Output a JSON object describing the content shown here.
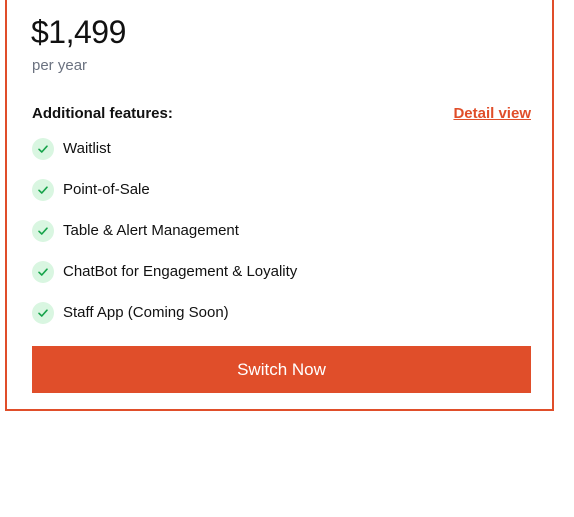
{
  "plan": {
    "price": "$1,499",
    "period": "per year"
  },
  "features": {
    "heading": "Additional features:",
    "detail_link": "Detail view",
    "items": [
      {
        "label": "Waitlist",
        "icon": "check-icon"
      },
      {
        "label": "Point-of-Sale",
        "icon": "check-icon"
      },
      {
        "label": "Table & Alert Management",
        "icon": "check-icon"
      },
      {
        "label": "ChatBot for Engagement & Loyality",
        "icon": "check-icon"
      },
      {
        "label": "Staff App (Coming Soon)",
        "icon": "check-icon"
      }
    ]
  },
  "cta": {
    "label": "Switch Now"
  },
  "colors": {
    "accent": "#e04e2a",
    "check_bg": "#d9f6e1",
    "check_mark": "#16a34a",
    "muted_text": "#6b7280"
  }
}
